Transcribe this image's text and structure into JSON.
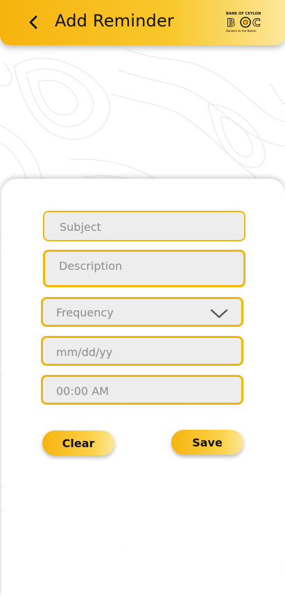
{
  "header": {
    "title": "Add Reminder",
    "back_icon": "chevron-left-icon",
    "logo": {
      "top": "BANK OF CEYLON",
      "mark": "BOC",
      "tagline": "Bankers to the Nation"
    },
    "gradient": [
      "#f6b40e",
      "#fde79a"
    ]
  },
  "form": {
    "subject_placeholder": "Subject",
    "description_placeholder": "Description",
    "frequency_placeholder": "Frequency",
    "date_placeholder": "mm/dd/yy",
    "time_placeholder": "00:00 AM",
    "dropdown_icon": "chevron-down-icon"
  },
  "actions": {
    "clear_label": "Clear",
    "save_label": "Save"
  },
  "colors": {
    "accent": "#f2b705",
    "field_bg": "#ededed",
    "placeholder": "#8c8c8c"
  }
}
